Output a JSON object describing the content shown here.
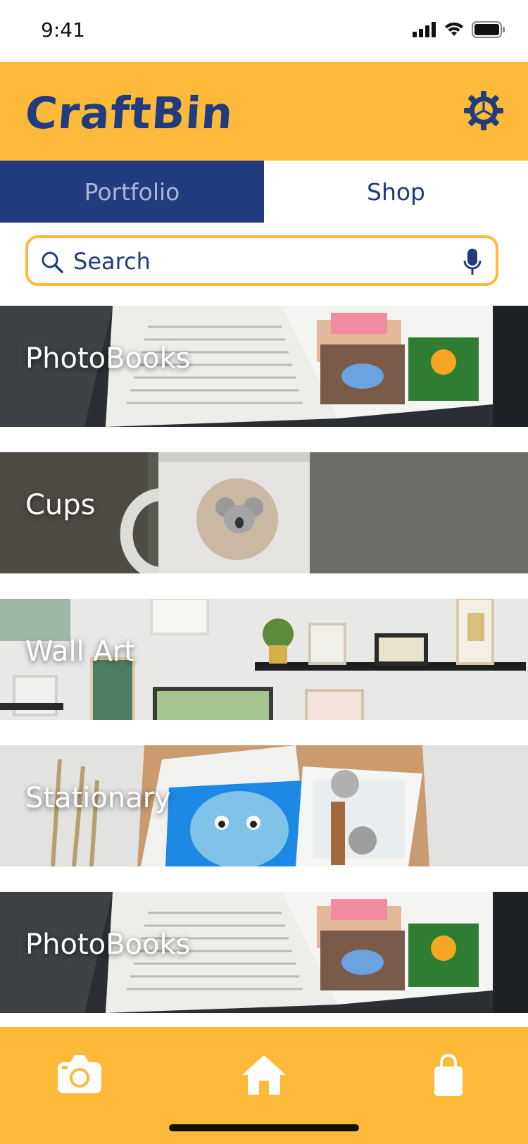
{
  "status_bar": {
    "time": "9:41"
  },
  "header": {
    "app_name": "CraftBin"
  },
  "tabs": [
    {
      "label": "Portfolio",
      "active": true
    },
    {
      "label": "Shop",
      "active": false
    }
  ],
  "search": {
    "placeholder": "Search"
  },
  "categories": [
    {
      "label": "PhotoBooks"
    },
    {
      "label": "Cups"
    },
    {
      "label": "Wall Art"
    },
    {
      "label": "Stationary"
    },
    {
      "label": "PhotoBooks"
    }
  ],
  "bottom_nav": {
    "items": [
      "camera",
      "home",
      "shopping-bag"
    ]
  },
  "colors": {
    "brand_yellow": "#FDBA3A",
    "brand_navy": "#213C7E",
    "tab_inactive_text": "#A9B6D6"
  }
}
